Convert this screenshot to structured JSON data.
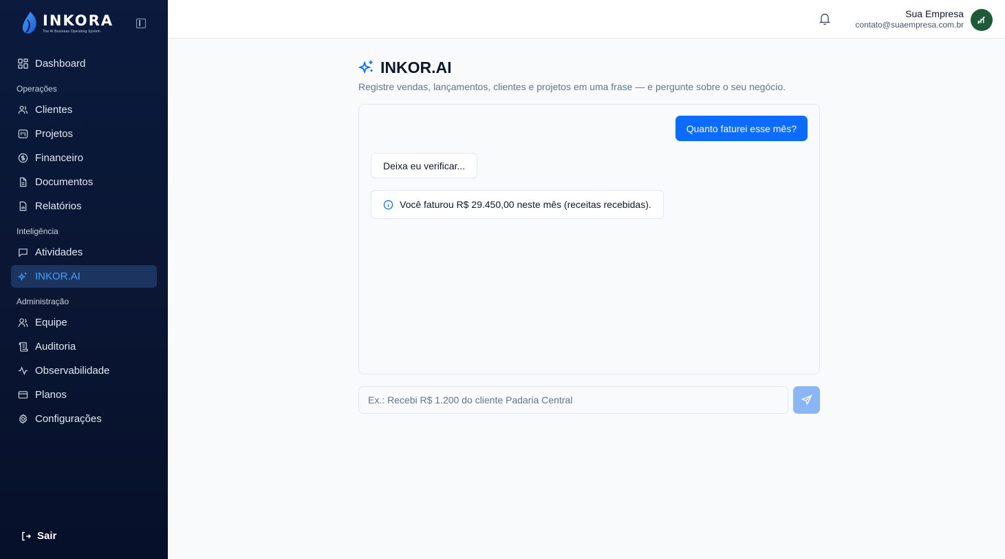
{
  "brand": {
    "name": "INKORA",
    "tagline": "The AI Business Operating System"
  },
  "nav": {
    "dashboard": "Dashboard",
    "sections": [
      {
        "label": "Operações",
        "items": [
          "Clientes",
          "Projetos",
          "Financeiro",
          "Documentos",
          "Relatórios"
        ]
      },
      {
        "label": "Inteligência",
        "items": [
          "Atividades",
          "INKOR.AI"
        ]
      },
      {
        "label": "Administração",
        "items": [
          "Equipe",
          "Auditoria",
          "Observabilidade",
          "Planos",
          "Configurações"
        ]
      }
    ],
    "active": "INKOR.AI",
    "logout": "Sair"
  },
  "header": {
    "company": "Sua Empresa",
    "email": "contato@suaempresa.com.br"
  },
  "page": {
    "title": "INKOR.AI",
    "subtitle": "Registre vendas, lançamentos, clientes e projetos em uma frase — e pergunte sobre o seu negócio."
  },
  "chat": {
    "messages": [
      {
        "role": "user",
        "text": "Quanto faturei esse mês?"
      },
      {
        "role": "assistant",
        "text": "Deixa eu verificar..."
      },
      {
        "role": "assistant",
        "text": "Você faturou R$ 29.450,00 neste mês (receitas recebidas)."
      }
    ],
    "input_placeholder": "Ex.: Recebi R$ 1.200 do cliente Padaria Central"
  },
  "colors": {
    "accent": "#0b6cff",
    "sidebar": "#0b1a3d",
    "active_text": "#3fa2ff"
  }
}
